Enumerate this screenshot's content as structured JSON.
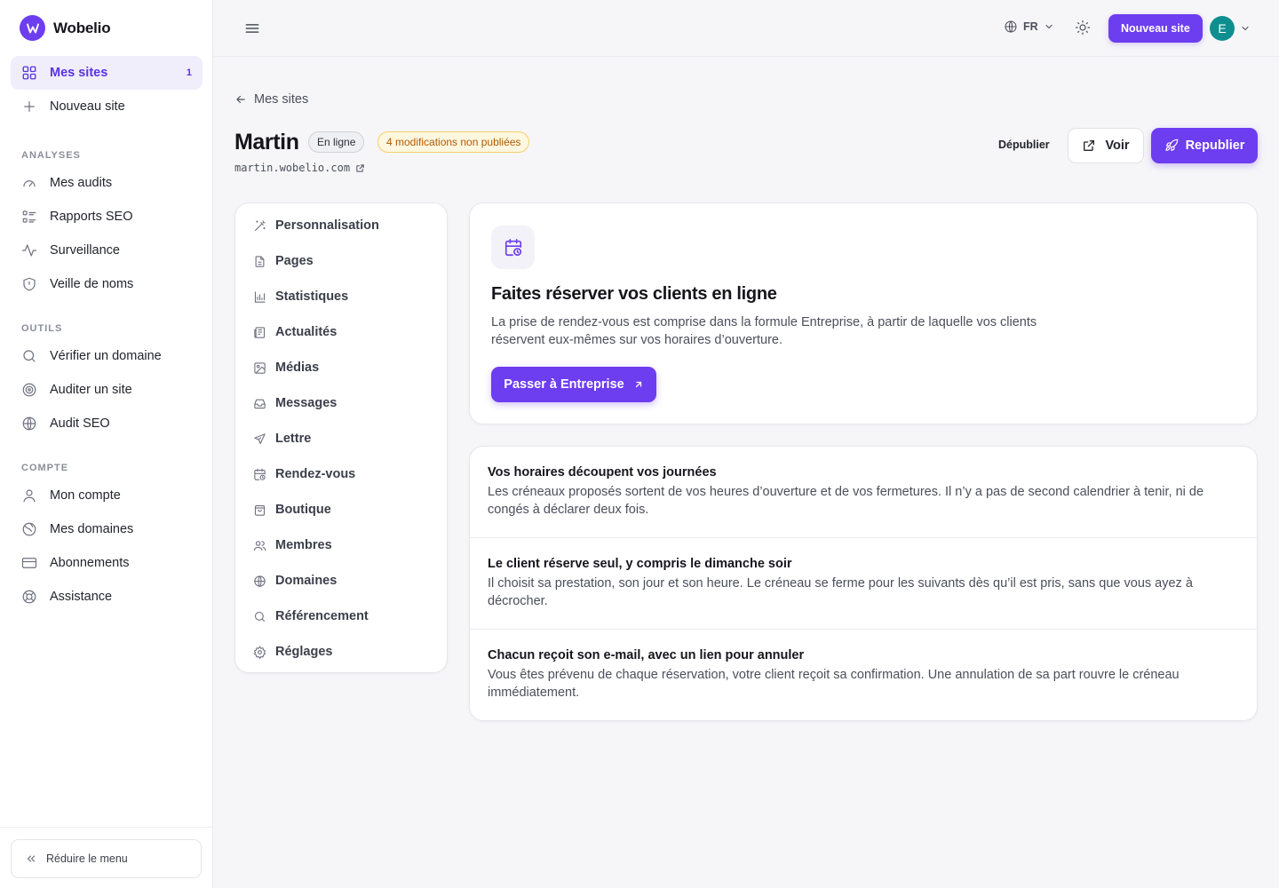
{
  "brand": {
    "name": "Wobelio"
  },
  "sidebar": {
    "main_items": [
      {
        "label": "Mes sites",
        "badge": "1",
        "icon": "grid-icon"
      },
      {
        "label": "Nouveau site",
        "icon": "plus-icon"
      }
    ],
    "sections": [
      {
        "title": "ANALYSES",
        "items": [
          {
            "label": "Mes audits",
            "icon": "gauge-icon"
          },
          {
            "label": "Rapports SEO",
            "icon": "list-icon"
          },
          {
            "label": "Surveillance",
            "icon": "activity-icon"
          },
          {
            "label": "Veille de noms",
            "icon": "shield-icon"
          }
        ]
      },
      {
        "title": "OUTILS",
        "items": [
          {
            "label": "Vérifier un domaine",
            "icon": "search-icon"
          },
          {
            "label": "Auditer un site",
            "icon": "target-icon"
          },
          {
            "label": "Audit SEO",
            "icon": "globe-icon"
          }
        ]
      },
      {
        "title": "COMPTE",
        "items": [
          {
            "label": "Mon compte",
            "icon": "user-icon"
          },
          {
            "label": "Mes domaines",
            "icon": "world-icon"
          },
          {
            "label": "Abonnements",
            "icon": "card-icon"
          },
          {
            "label": "Assistance",
            "icon": "lifebuoy-icon"
          }
        ]
      }
    ],
    "collapse_label": "Réduire le menu"
  },
  "topbar": {
    "lang": "FR",
    "new_site_label": "Nouveau site",
    "avatar_initial": "E"
  },
  "header": {
    "back_label": "Mes sites",
    "site_name": "Martin",
    "status": "En ligne",
    "pending": "4 modifications non publiées",
    "domain": "martin.wobelio.com",
    "unpublish_label": "Dépublier",
    "view_label": "Voir",
    "republish_label": "Republier"
  },
  "subnav": [
    {
      "label": "Personnalisation",
      "icon": "wand-icon"
    },
    {
      "label": "Pages",
      "icon": "file-icon"
    },
    {
      "label": "Statistiques",
      "icon": "bar-chart-icon"
    },
    {
      "label": "Actualités",
      "icon": "newspaper-icon"
    },
    {
      "label": "Médias",
      "icon": "image-icon"
    },
    {
      "label": "Messages",
      "icon": "inbox-icon"
    },
    {
      "label": "Lettre",
      "icon": "send-icon"
    },
    {
      "label": "Rendez-vous",
      "icon": "calendar-clock-icon"
    },
    {
      "label": "Boutique",
      "icon": "shopping-bag-icon"
    },
    {
      "label": "Membres",
      "icon": "users-icon"
    },
    {
      "label": "Domaines",
      "icon": "globe-icon"
    },
    {
      "label": "Référencement",
      "icon": "search-icon"
    },
    {
      "label": "Réglages",
      "icon": "gear-icon"
    }
  ],
  "promo": {
    "title": "Faites réserver vos clients en ligne",
    "description": "La prise de rendez-vous est comprise dans la formule Entreprise, à partir de laquelle vos clients réservent eux-mêmes sur vos horaires d’ouverture.",
    "button_label": "Passer à Entreprise"
  },
  "features": [
    {
      "title": "Vos horaires découpent vos journées",
      "description": "Les créneaux proposés sortent de vos heures d’ouverture et de vos fermetures. Il n’y a pas de second calendrier à tenir, ni de congés à déclarer deux fois."
    },
    {
      "title": "Le client réserve seul, y compris le dimanche soir",
      "description": "Il choisit sa prestation, son jour et son heure. Le créneau se ferme pour les suivants dès qu’il est pris, sans que vous ayez à décrocher."
    },
    {
      "title": "Chacun reçoit son e-mail, avec un lien pour annuler",
      "description": "Vous êtes prévenu de chaque réservation, votre client reçoit sa confirmation. Une annulation de sa part rouvre le créneau immédiatement."
    }
  ]
}
